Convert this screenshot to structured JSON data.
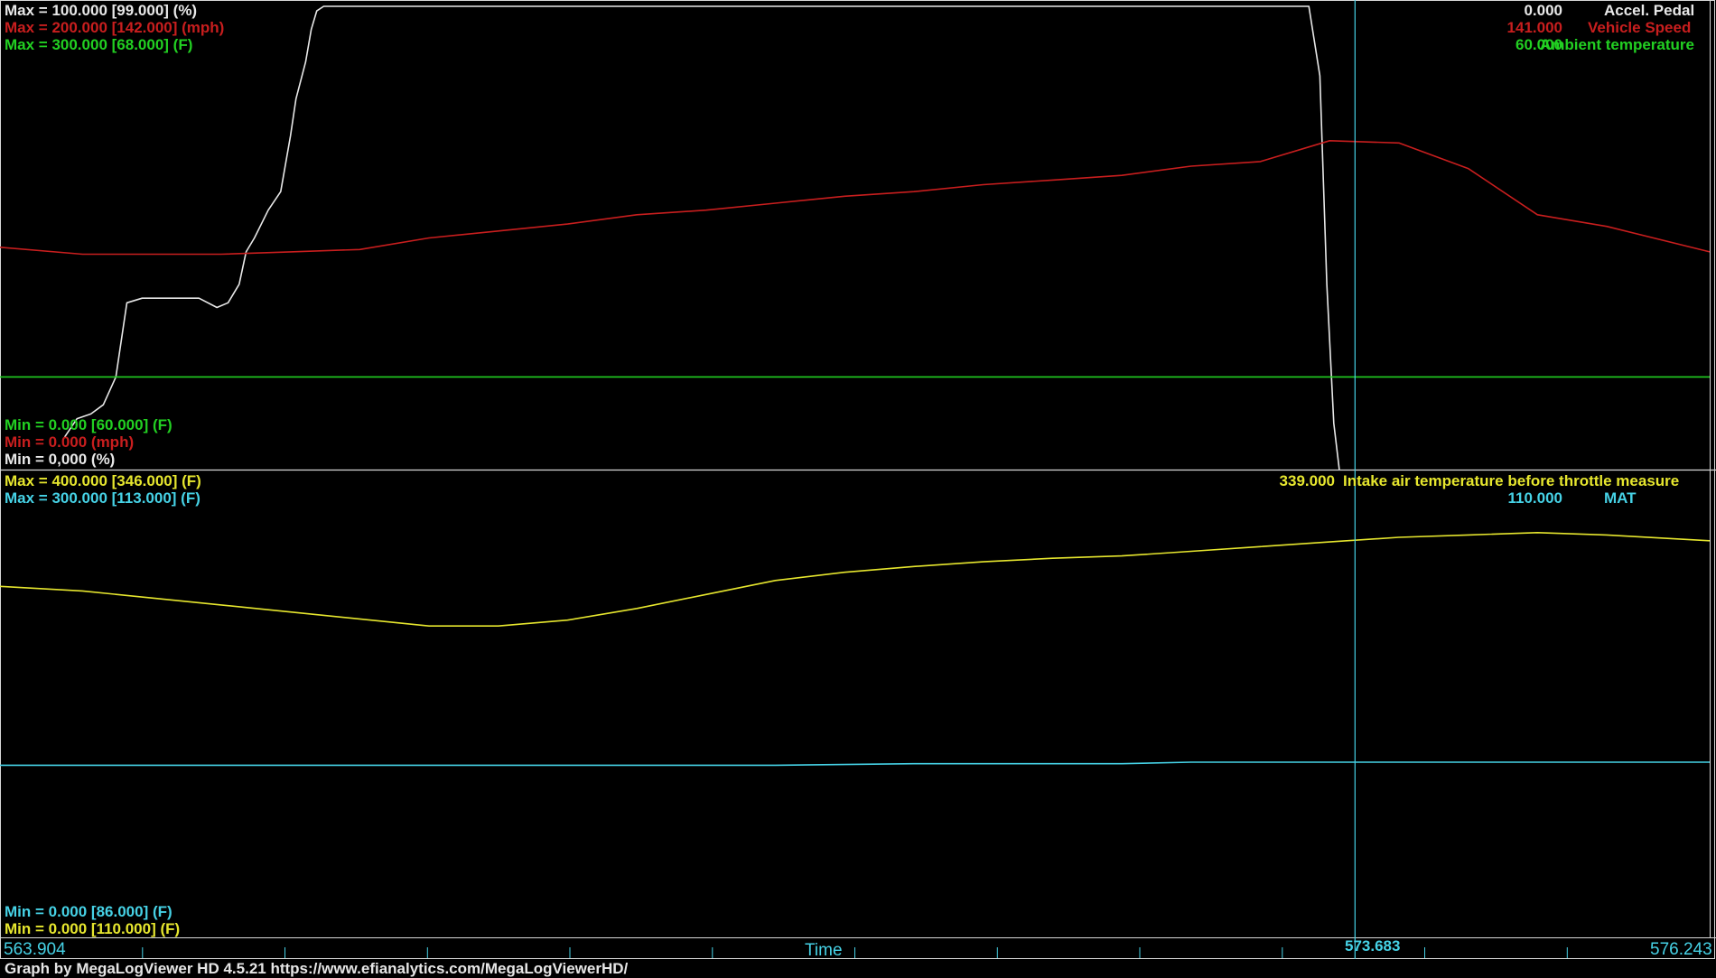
{
  "app": {
    "footer": "Graph by MegaLogViewer HD 4.5.21 https://www.efianalytics.com/MegaLogViewerHD/"
  },
  "colors": {
    "background": "#000000",
    "accel_pedal": "#e8e8e8",
    "vehicle_speed": "#c81e1e",
    "ambient_temp": "#22d022",
    "intake_air_temp": "#e6e62e",
    "mat": "#46d2e6",
    "cursor": "#46d2e6"
  },
  "graph_top": {
    "left_labels": {
      "accel_max": "Max = 100.000 [99.000] (%)",
      "speed_max": "Max = 200.000 [142.000] (mph)",
      "ambient_max": "Max = 300.000 [68.000] (F)",
      "ambient_min": "Min = 0.000 [60.000] (F)",
      "speed_min": "Min = 0.000 (mph)",
      "accel_min": "Min = 0,000 (%)"
    },
    "right_labels": {
      "accel_value": "0.000",
      "accel_name": "Accel. Pedal",
      "speed_value": "141.000",
      "speed_name": "Vehicle Speed",
      "ambient_value": "60.000",
      "ambient_name": "Ambient temperature"
    }
  },
  "graph_bottom": {
    "left_labels": {
      "iat_max": "Max = 400.000 [346.000] (F)",
      "mat_max": "Max = 300.000 [113.000] (F)",
      "mat_min": "Min = 0.000 [86.000] (F)",
      "iat_min": "Min = 0.000 [110.000] (F)"
    },
    "right_labels": {
      "iat_value": "339.000",
      "iat_name": "Intake air temperature before throttle measure",
      "mat_value": "110.000",
      "mat_name": "MAT"
    }
  },
  "time_axis": {
    "label": "Time",
    "start": "563.904",
    "cursor": "573.683",
    "end": "576.243"
  },
  "chart_data": [
    {
      "type": "line",
      "xlabel": "Time",
      "xlim": [
        563.904,
        576.243
      ],
      "series": [
        {
          "name": "Accel. Pedal",
          "unit": "%",
          "ylim": [
            0,
            100
          ],
          "color": "#e8e8e8",
          "x": [
            564.37,
            564.46,
            564.56,
            564.65,
            564.74,
            564.82,
            564.93,
            564.98,
            565.08,
            565.34,
            565.47,
            565.55,
            565.63,
            565.68,
            565.74,
            565.84,
            565.93,
            566.0,
            566.04,
            566.11,
            566.15,
            566.19,
            566.24,
            566.29,
            573.35,
            573.43,
            573.48,
            573.53,
            573.57
          ],
          "y": [
            7,
            11,
            12,
            14,
            20,
            36,
            37,
            37,
            37,
            37,
            35,
            36,
            40,
            47,
            50,
            56,
            60,
            72,
            80,
            88,
            95,
            99,
            100,
            100,
            100,
            85,
            40,
            10,
            0
          ]
        },
        {
          "name": "Vehicle Speed",
          "unit": "mph",
          "ylim": [
            0,
            200
          ],
          "color": "#c81e1e",
          "x": [
            563.904,
            564.5,
            565.0,
            565.5,
            566.0,
            566.5,
            567.0,
            567.5,
            568.0,
            568.5,
            569.0,
            569.5,
            570.0,
            570.5,
            571.0,
            571.5,
            572.0,
            572.5,
            573.0,
            573.5,
            574.0,
            574.5,
            575.0,
            575.5,
            576.243
          ],
          "y": [
            96,
            93,
            93,
            93,
            94,
            95,
            100,
            103,
            106,
            110,
            112,
            115,
            118,
            120,
            123,
            125,
            127,
            131,
            133,
            142,
            141,
            130,
            110,
            105,
            94
          ]
        },
        {
          "name": "Ambient temperature",
          "unit": "F",
          "ylim": [
            0,
            300
          ],
          "color": "#22d022",
          "x": [
            563.904,
            576.243
          ],
          "y": [
            60,
            60
          ]
        },
        {
          "name": "Intake air temperature before throttle measure",
          "unit": "F",
          "ylim": [
            0,
            400
          ],
          "color": "#e6e62e",
          "x": [
            563.904,
            564.5,
            565.0,
            565.5,
            566.0,
            566.5,
            567.0,
            567.5,
            568.0,
            568.5,
            569.0,
            569.5,
            570.0,
            570.5,
            571.0,
            571.5,
            572.0,
            572.5,
            573.0,
            573.5,
            574.0,
            574.5,
            575.0,
            575.5,
            576.243
          ],
          "y": [
            300,
            296,
            290,
            284,
            278,
            272,
            266,
            266,
            271,
            281,
            293,
            305,
            312,
            317,
            321,
            324,
            326,
            330,
            334,
            338,
            342,
            344,
            346,
            344,
            339
          ]
        },
        {
          "name": "MAT",
          "unit": "F",
          "ylim": [
            0,
            300
          ],
          "color": "#46d2e6",
          "x": [
            563.904,
            566.0,
            568.0,
            569.5,
            570.5,
            572.0,
            572.5,
            573.5,
            576.243
          ],
          "y": [
            110,
            110,
            110,
            110,
            111,
            111,
            112,
            112,
            112
          ]
        }
      ]
    }
  ]
}
